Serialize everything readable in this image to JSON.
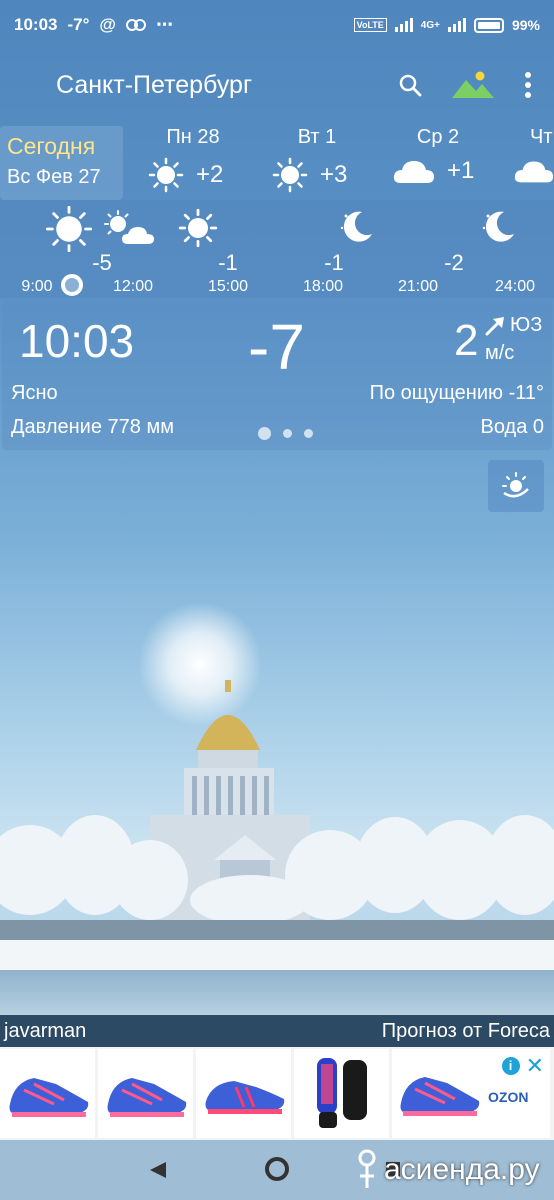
{
  "status_bar": {
    "time": "10:03",
    "temp": "-7°",
    "network": "4G+",
    "lte": "VoLTE",
    "battery": "99%"
  },
  "app_bar": {
    "city": "Санкт-Петербург",
    "icons": [
      "search-icon",
      "landscape-icon",
      "more-vert-icon"
    ]
  },
  "days": [
    {
      "label": "Сегодня",
      "date": "Вс Фев 27",
      "selected": true
    },
    {
      "label": "Пн 28",
      "temp": "+2",
      "icon": "sun"
    },
    {
      "label": "Вт 1",
      "temp": "+3",
      "icon": "sun"
    },
    {
      "label": "Ср 2",
      "temp": "+1",
      "icon": "cloud"
    },
    {
      "label": "Чт",
      "icon": "cloud"
    }
  ],
  "hourly": {
    "temps": [
      "-5",
      "-1",
      "-1",
      "-2"
    ],
    "times": [
      "9:00",
      "12:00",
      "15:00",
      "18:00",
      "21:00",
      "24:00"
    ]
  },
  "current": {
    "time": "10:03",
    "temp": "-7",
    "wind_speed": "2",
    "wind_dir": "ЮЗ",
    "wind_unit": "м/с",
    "condition": "Ясно",
    "feels_like": "По ощущению -11°",
    "pressure": "Давление 778 мм",
    "water": "Вода 0",
    "page_count": 3,
    "active_page": 1
  },
  "credits": {
    "author": "javarman",
    "provider": "Прогноз от Foreca"
  },
  "ad": {
    "brand": "OZON"
  },
  "watermark": "асиенда.ру",
  "colors": {
    "today_label": "#ffe48a",
    "credits_bg": "#2c4a63",
    "ozon": "#2a5fb8"
  }
}
